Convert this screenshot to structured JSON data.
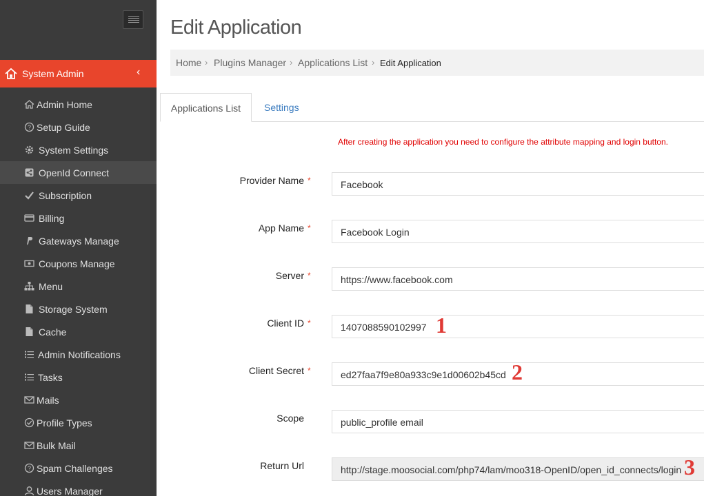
{
  "sidebar": {
    "section_title": "System Admin",
    "items": [
      {
        "label": "Admin Home",
        "icon": "home-outline-icon"
      },
      {
        "label": "Setup Guide",
        "icon": "question-circle-icon"
      },
      {
        "label": "System Settings",
        "icon": "gear-icon"
      },
      {
        "label": "OpenId Connect",
        "icon": "share-square-icon"
      },
      {
        "label": "Subscription",
        "icon": "check-icon"
      },
      {
        "label": "Billing",
        "icon": "credit-card-icon"
      },
      {
        "label": "Gateways Manage",
        "icon": "paypal-icon"
      },
      {
        "label": "Coupons Manage",
        "icon": "money-icon"
      },
      {
        "label": "Menu",
        "icon": "sitemap-icon"
      },
      {
        "label": "Storage System",
        "icon": "file-icon"
      },
      {
        "label": "Cache",
        "icon": "file-icon"
      },
      {
        "label": "Admin Notifications",
        "icon": "list-icon"
      },
      {
        "label": "Tasks",
        "icon": "list-icon"
      },
      {
        "label": "Mails",
        "icon": "envelope-icon"
      },
      {
        "label": "Profile Types",
        "icon": "check-circle-icon"
      },
      {
        "label": "Bulk Mail",
        "icon": "envelope-icon"
      },
      {
        "label": "Spam Challenges",
        "icon": "question-circle-icon"
      },
      {
        "label": "Users Manager",
        "icon": "user-icon"
      }
    ]
  },
  "header": {
    "title": "Edit Application",
    "breadcrumb": [
      "Home",
      "Plugins Manager",
      "Applications List",
      "Edit Application"
    ]
  },
  "tabs": [
    {
      "label": "Applications List"
    },
    {
      "label": "Settings"
    }
  ],
  "notice": "After creating the application you need to configure the attribute mapping and login button.",
  "form": {
    "provider_name": {
      "label": "Provider Name",
      "value": "Facebook"
    },
    "app_name": {
      "label": "App Name",
      "value": "Facebook Login"
    },
    "server": {
      "label": "Server",
      "value": "https://www.facebook.com"
    },
    "client_id": {
      "label": "Client ID",
      "value": "1407088590102997"
    },
    "client_secret": {
      "label": "Client Secret",
      "value": "ed27faa7f9e80a933c9e1d00602b45cd"
    },
    "scope": {
      "label": "Scope",
      "value": "public_profile email"
    },
    "return_url": {
      "label": "Return Url",
      "value": "http://stage.moosocial.com/php74/lam/moo318-OpenID/open_id_connects/login"
    },
    "required_mark": "*"
  },
  "markers": [
    "1",
    "2",
    "3"
  ],
  "colors": {
    "sidebar_bg": "#3b3b3b",
    "accent": "#e8452c",
    "link": "#3a7bbf",
    "notice": "#e00000",
    "marker": "#e03a35"
  }
}
